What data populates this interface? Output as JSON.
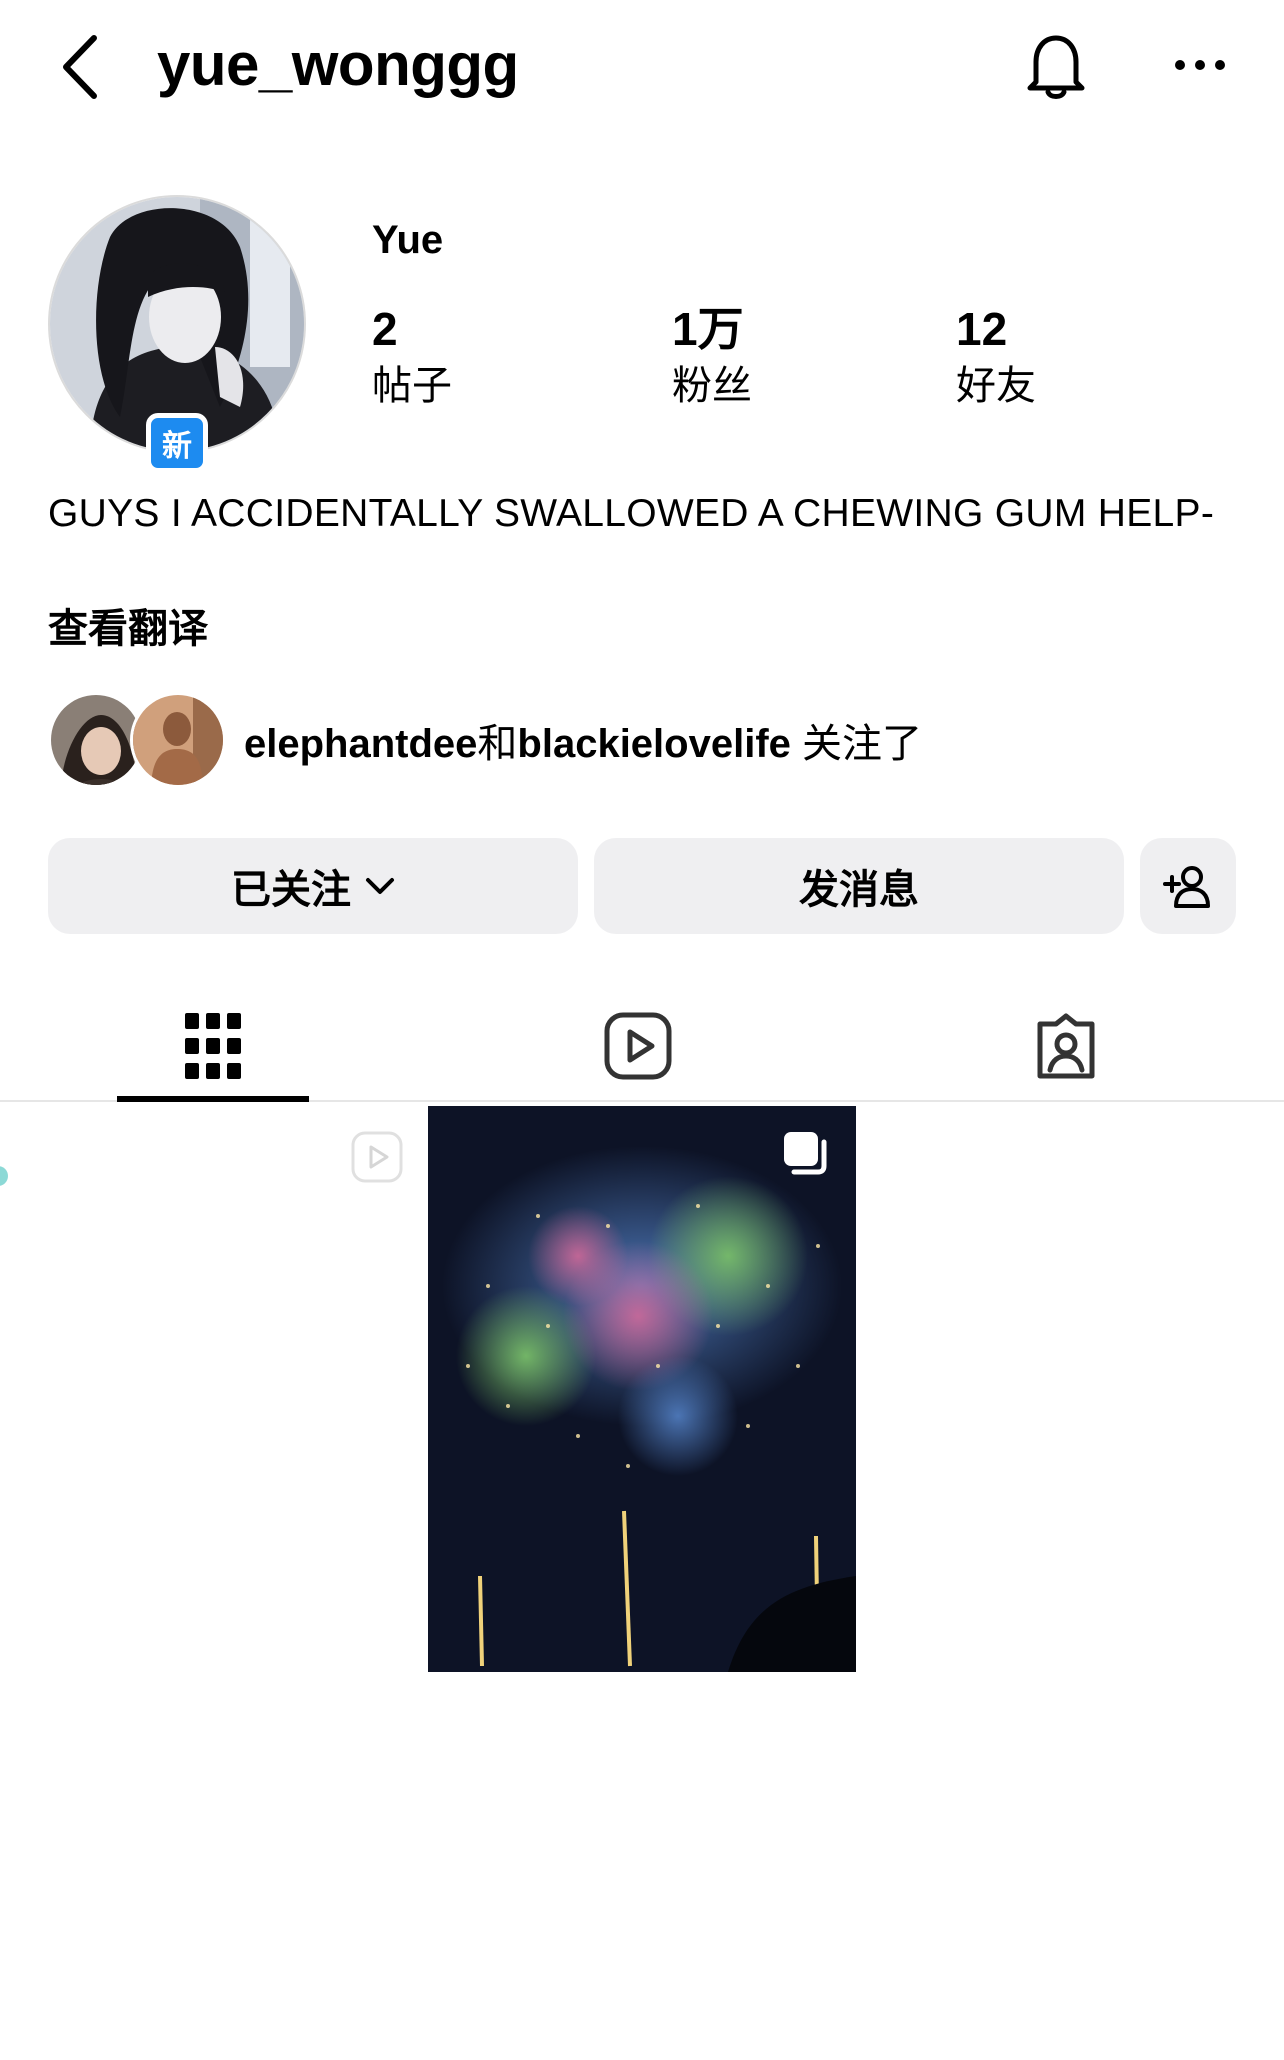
{
  "topbar": {
    "username": "yue_wonggg",
    "icons": [
      "back-arrow-icon",
      "bell-icon",
      "more-dots-icon"
    ]
  },
  "profile": {
    "display_name": "Yue",
    "new_badge": "新",
    "stats": {
      "posts": {
        "value": "2",
        "label": "帖子"
      },
      "followers": {
        "value": "1万",
        "label": "粉丝"
      },
      "friends": {
        "value": "12",
        "label": "好友"
      }
    },
    "bio": "GUYS I ACCIDENTALLY SWALLOWED A CHEWING GUM HELP-",
    "translate_link": "查看翻译"
  },
  "mutuals": {
    "user1": "elephantdee",
    "connector": "和",
    "user2": "blackielovelife",
    "suffix": "关注了"
  },
  "actions": {
    "following_label": "已关注",
    "message_label": "发消息"
  },
  "tabs": [
    "grid-icon",
    "reels-icon",
    "tagged-icon"
  ],
  "colors": {
    "badge_blue": "#1d8bf0",
    "button_bg": "#efeff1",
    "divider": "#e6e6e6"
  }
}
